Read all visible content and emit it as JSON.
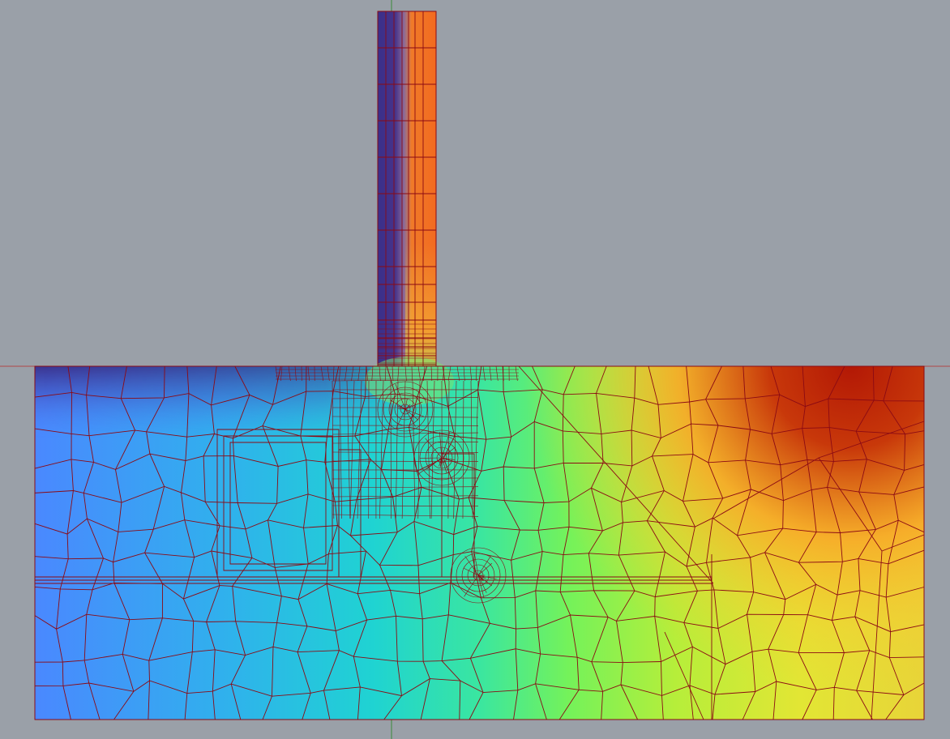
{
  "viewport": {
    "background": "#9aa0a8",
    "axis_colors": {
      "horizontal": "#b04848",
      "vertical": "#3a8a3a"
    }
  },
  "mesh": {
    "line_color": "#8b0a14",
    "colormap": [
      "#3a2f8a",
      "#4a8cff",
      "#1fd1d6",
      "#5cf070",
      "#d4ec30",
      "#f8b530",
      "#b11a05"
    ]
  }
}
